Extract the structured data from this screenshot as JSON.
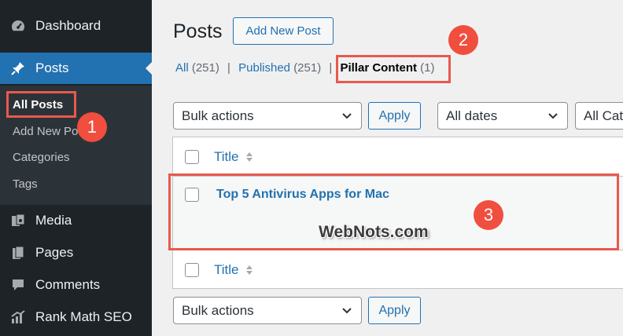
{
  "sidebar": {
    "items": [
      {
        "label": "Dashboard",
        "icon": "dashboard-icon"
      },
      {
        "label": "Posts",
        "icon": "pin-icon"
      },
      {
        "label": "Media",
        "icon": "media-icon"
      },
      {
        "label": "Pages",
        "icon": "pages-icon"
      },
      {
        "label": "Comments",
        "icon": "comments-icon"
      },
      {
        "label": "Rank Math SEO",
        "icon": "rankmath-icon"
      }
    ],
    "submenu": [
      "All Posts",
      "Add New Po",
      "Categories",
      "Tags"
    ]
  },
  "header": {
    "title": "Posts",
    "add_new": "Add New Post"
  },
  "views": {
    "all_label": "All",
    "all_count": "(251)",
    "published_label": "Published",
    "published_count": "(251)",
    "pillar_label": "Pillar Content",
    "pillar_count": "(1)",
    "separator": "|"
  },
  "toolbar": {
    "bulk_actions": "Bulk actions",
    "apply": "Apply",
    "dates": "All dates",
    "categories": "All Cat"
  },
  "table": {
    "column_title": "Title",
    "rows": [
      {
        "title": "Top 5 Antivirus Apps for Mac"
      }
    ]
  },
  "annotations": {
    "badges": [
      "1",
      "2",
      "3"
    ],
    "watermark": "WebNots.com"
  },
  "colors": {
    "accent": "#2271b1",
    "sidebar": "#1d2327",
    "highlight": "#e8594d",
    "badge": "#f04e3e"
  }
}
